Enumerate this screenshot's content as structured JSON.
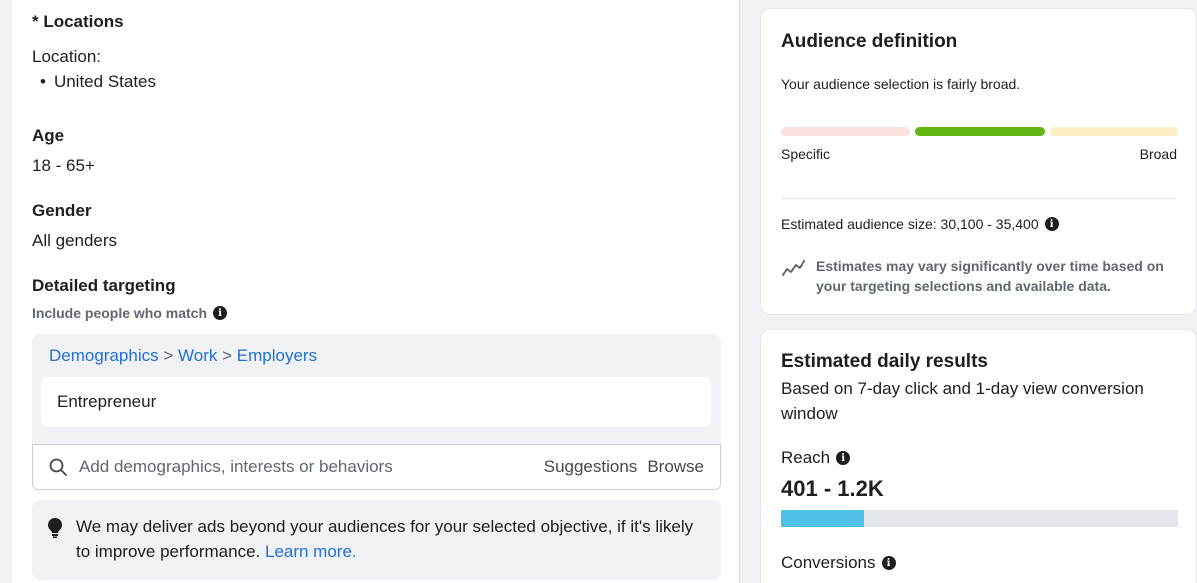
{
  "targeting": {
    "locations_heading": "* Locations",
    "location_label": "Location:",
    "location_items": [
      "United States"
    ],
    "age_heading": "Age",
    "age_value": "18 - 65+",
    "gender_heading": "Gender",
    "gender_value": "All genders",
    "detailed_heading": "Detailed targeting",
    "include_label": "Include people who match",
    "breadcrumb": [
      "Demographics",
      "Work",
      "Employers"
    ],
    "breadcrumb_sep": ">",
    "selected_item": "Entrepreneur",
    "search_placeholder": "Add demographics, interests or behaviors",
    "suggestions_label": "Suggestions",
    "browse_label": "Browse",
    "notice_text": "We may deliver ads beyond your audiences for your selected objective, if it's likely to improve performance.",
    "learn_more": "Learn more."
  },
  "audience": {
    "title": "Audience definition",
    "summary": "Your audience selection is fairly broad.",
    "meter_position": "broad-middle",
    "meter_left_label": "Specific",
    "meter_right_label": "Broad",
    "colors": {
      "specific": "#fde2e2",
      "active": "#62b612",
      "broad": "#fdf0c4"
    },
    "size_label": "Estimated audience size: 30,100 - 35,400",
    "disclaimer": "Estimates may vary significantly over time based on your targeting selections and available data."
  },
  "results": {
    "title": "Estimated daily results",
    "subtitle": "Based on 7-day click and 1-day view conversion window",
    "reach_label": "Reach",
    "reach_value": "401 - 1.2K",
    "reach_fill_fraction": 0.21,
    "reach_bar_color": "#4fc1e9",
    "conversions_label": "Conversions"
  },
  "icons": {
    "info": "info-icon",
    "search": "search-icon",
    "lightbulb": "lightbulb-icon",
    "trend": "trend-icon"
  }
}
